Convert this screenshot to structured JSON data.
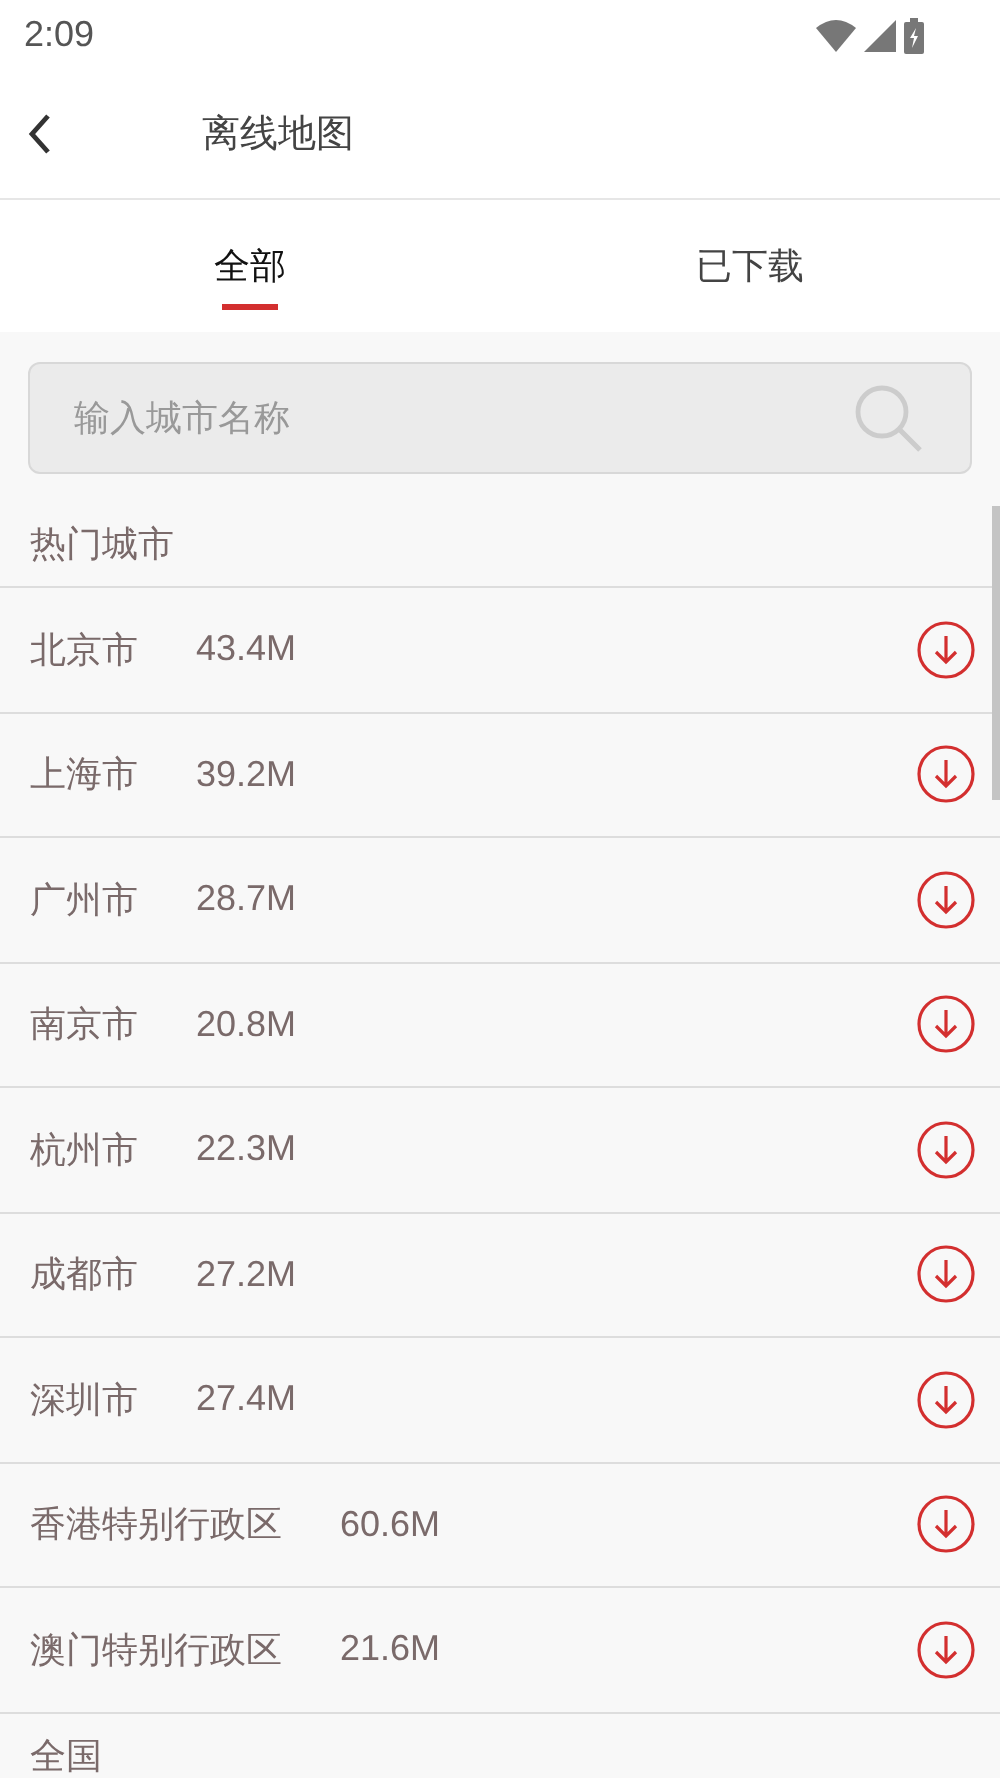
{
  "status_bar": {
    "time": "2:09"
  },
  "app_bar": {
    "title": "离线地图"
  },
  "tabs": [
    {
      "label": "全部",
      "selected": true
    },
    {
      "label": "已下载",
      "selected": false
    }
  ],
  "search": {
    "placeholder": "输入城市名称"
  },
  "sections": [
    {
      "title": "热门城市",
      "cities": [
        {
          "name": "北京市",
          "size": "43.4M"
        },
        {
          "name": "上海市",
          "size": "39.2M"
        },
        {
          "name": "广州市",
          "size": "28.7M"
        },
        {
          "name": "南京市",
          "size": "20.8M"
        },
        {
          "name": "杭州市",
          "size": "22.3M"
        },
        {
          "name": "成都市",
          "size": "27.2M"
        },
        {
          "name": "深圳市",
          "size": "27.4M"
        },
        {
          "name": "香港特别行政区",
          "size": "60.6M"
        },
        {
          "name": "澳门特别行政区",
          "size": "21.6M"
        }
      ]
    },
    {
      "title": "全国"
    }
  ]
}
